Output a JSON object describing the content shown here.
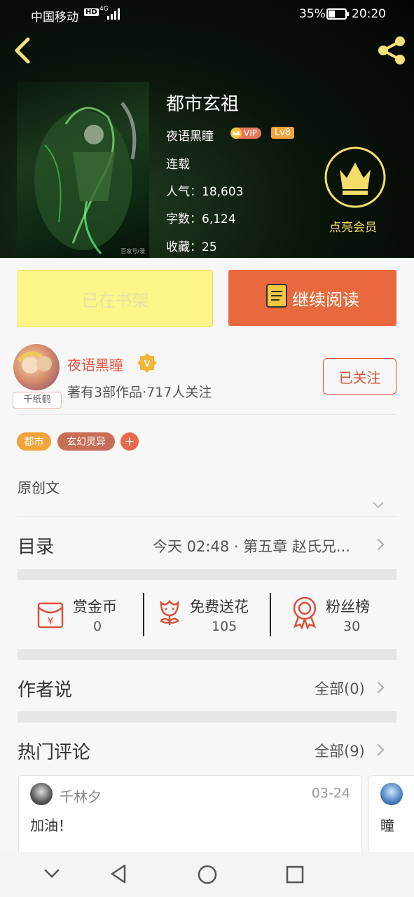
{
  "status_bar": {
    "carrier": "中国移动",
    "hd": "HD",
    "net": "4G",
    "battery": "35%",
    "time": "20:20"
  },
  "book": {
    "title": "都市玄祖",
    "author": "夜语黑瞳",
    "vip": "VIP",
    "level": "Lv8",
    "status": "连载",
    "popularity": "人气：18,603",
    "words": "字数：6,124",
    "favorites": "收藏：25",
    "cover_watermark": "百家号/漫"
  },
  "member": {
    "label": "点亮会员"
  },
  "actions": {
    "shelf": "已在书架",
    "read": "继续阅读"
  },
  "author": {
    "name": "夜语黑瞳",
    "verified": "V",
    "stats": "著有3部作品·717人关注",
    "avatar_tag": "千纸鹤",
    "follow": "已关注",
    "colors": {
      "name": "#e5533d"
    }
  },
  "tags": [
    {
      "label": "都市",
      "color": "#f2a43b"
    },
    {
      "label": "玄幻灵异",
      "color": "#c86e57"
    },
    {
      "label": "+",
      "color": "#e8694a"
    }
  ],
  "intro": "原创文",
  "toc": {
    "label": "目录",
    "latest": "今天 02:48 · 第五章  赵氏兄..."
  },
  "rewards": [
    {
      "label": "赏金币",
      "value": "0",
      "icon": "red-envelope-icon"
    },
    {
      "label": "免费送花",
      "value": "105",
      "icon": "flower-icon"
    },
    {
      "label": "粉丝榜",
      "value": "30",
      "icon": "medal-icon"
    }
  ],
  "author_says": {
    "label": "作者说",
    "all": "全部(0)"
  },
  "hot_comments": {
    "label": "热门评论",
    "all": "全部(9)"
  },
  "comments": [
    {
      "user": "千林夕",
      "date": "03-24",
      "text": "加油！"
    },
    {
      "user": "",
      "date": "",
      "text": "瞳"
    }
  ],
  "accent": "#e8693d"
}
